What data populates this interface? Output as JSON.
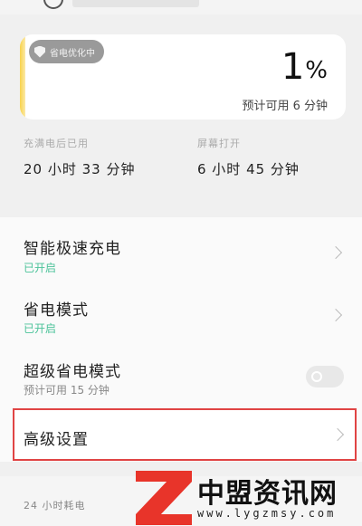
{
  "battery": {
    "saver_chip": "省电优化中",
    "percent": "1",
    "percent_symbol": "%",
    "level_fraction": 0.01,
    "remaining": "预计可用 6 分钟"
  },
  "stats": {
    "since_full": {
      "label": "充满电后已用",
      "value": "20 小时 33 分钟"
    },
    "screen_on": {
      "label": "屏幕打开",
      "value": "6 小时 45 分钟"
    }
  },
  "settings": {
    "smart_charge": {
      "title": "智能极速充电",
      "status": "已开启"
    },
    "power_saving": {
      "title": "省电模式",
      "status": "已开启"
    },
    "super_saving": {
      "title": "超级省电模式",
      "status": "预计可用 15 分钟"
    },
    "advanced": {
      "title": "高级设置"
    }
  },
  "footer": {
    "label": "24 小时耗电"
  },
  "watermark": {
    "title": "中盟资讯网",
    "url": "www.lygzmsy.com"
  },
  "colors": {
    "accent_green": "#4cc39a",
    "battery_yellow": "#f8d24a",
    "highlight_red": "#e04444",
    "watermark_red": "#e8342a"
  }
}
